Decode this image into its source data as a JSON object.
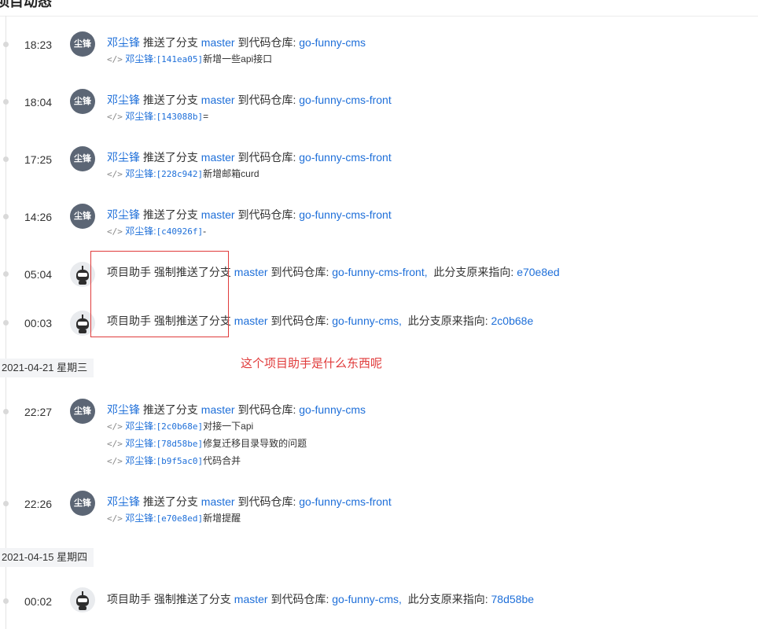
{
  "header": {
    "title": "项目动态"
  },
  "verbs": {
    "push": "推送了分支",
    "force": "强制推送了分支",
    "to_repo": "到代码仓库:",
    "prev": "此分支原来指向:"
  },
  "events": [
    {
      "time": "18:23",
      "avatar": "尘锋",
      "user": "邓尘锋",
      "branch": "master",
      "repo": "go-funny-cms",
      "commits": [
        {
          "author": "邓尘锋:",
          "hash": "[141ea05]",
          "msg": "新增一些api接口"
        }
      ]
    },
    {
      "time": "18:04",
      "avatar": "尘锋",
      "user": "邓尘锋",
      "branch": "master",
      "repo": "go-funny-cms-front",
      "commits": [
        {
          "author": "邓尘锋:",
          "hash": "[143088b]",
          "msg": "="
        }
      ]
    },
    {
      "time": "17:25",
      "avatar": "尘锋",
      "user": "邓尘锋",
      "branch": "master",
      "repo": "go-funny-cms-front",
      "commits": [
        {
          "author": "邓尘锋:",
          "hash": "[228c942]",
          "msg": "新增邮箱curd"
        }
      ]
    },
    {
      "time": "14:26",
      "avatar": "尘锋",
      "user": "邓尘锋",
      "branch": "master",
      "repo": "go-funny-cms-front",
      "commits": [
        {
          "author": "邓尘锋:",
          "hash": "[c40926f]",
          "msg": "-"
        }
      ]
    },
    {
      "time": "05:04",
      "user": "项目助手",
      "branch": "master",
      "repo": "go-funny-cms-front,",
      "prev": "e70e8ed"
    },
    {
      "time": "00:03",
      "user": "项目助手",
      "branch": "master",
      "repo": "go-funny-cms,",
      "prev": "2c0b68e"
    },
    {
      "time": "22:27",
      "avatar": "尘锋",
      "user": "邓尘锋",
      "branch": "master",
      "repo": "go-funny-cms",
      "commits": [
        {
          "author": "邓尘锋:",
          "hash": "[2c0b68e]",
          "msg": "对接一下api"
        },
        {
          "author": "邓尘锋:",
          "hash": "[78d58be]",
          "msg": "修复迁移目录导致的问题"
        },
        {
          "author": "邓尘锋:",
          "hash": "[b9f5ac0]",
          "msg": "代码合并"
        }
      ]
    },
    {
      "time": "22:26",
      "avatar": "尘锋",
      "user": "邓尘锋",
      "branch": "master",
      "repo": "go-funny-cms-front",
      "commits": [
        {
          "author": "邓尘锋:",
          "hash": "[e70e8ed]",
          "msg": "新增提醒"
        }
      ]
    },
    {
      "time": "00:02",
      "user": "项目助手",
      "branch": "master",
      "repo": "go-funny-cms,",
      "prev": "78d58be"
    }
  ],
  "dates": [
    "2021-04-21 星期三",
    "2021-04-15 星期四"
  ],
  "annotation": "这个项目助手是什么东西呢",
  "colors": {
    "link": "#1e6fd9",
    "annotation": "#e03b3b"
  }
}
